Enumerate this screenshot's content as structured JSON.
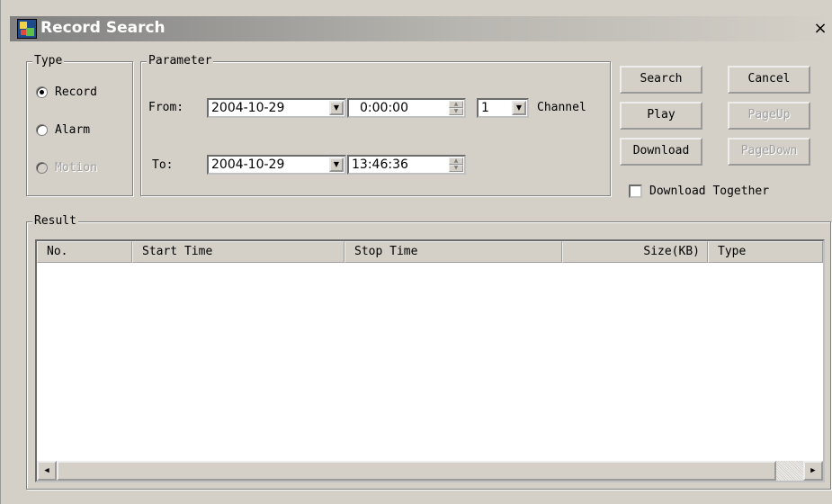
{
  "window": {
    "title": "Record Search",
    "close_label": "×",
    "icon": "app-icon"
  },
  "type_group": {
    "legend": "Type",
    "options": [
      {
        "label": "Record",
        "selected": true,
        "enabled": true
      },
      {
        "label": "Alarm",
        "selected": false,
        "enabled": true
      },
      {
        "label": "Motion",
        "selected": false,
        "enabled": false
      }
    ]
  },
  "parameter_group": {
    "legend": "Parameter",
    "from_label": "From:",
    "from_date": "2004-10-29",
    "from_time": "0:00:00",
    "to_label": "To:",
    "to_date": "2004-10-29",
    "to_time": "13:46:36",
    "channel_value": "1",
    "channel_label": "Channel"
  },
  "buttons": {
    "search": "Search",
    "cancel": "Cancel",
    "play": "Play",
    "page_up": "PageUp",
    "download": "Download",
    "page_down": "PageDown"
  },
  "download_together": {
    "label": "Download Together",
    "checked": false
  },
  "result_group": {
    "legend": "Result",
    "columns": [
      "No.",
      "Start Time",
      "Stop Time",
      "Size(KB)",
      "Type"
    ],
    "rows": []
  },
  "colors": {
    "dialog_bg": "#d4d0c8",
    "title_gradient_start": "#808080",
    "disabled_text": "#a0a0a0"
  }
}
